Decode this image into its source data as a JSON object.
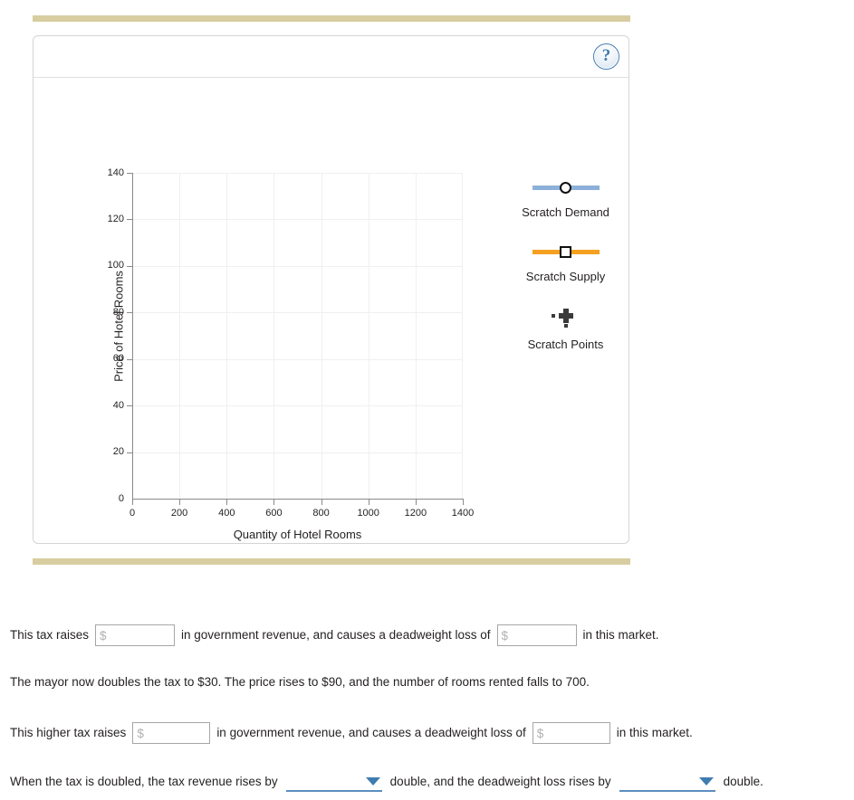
{
  "colors": {
    "rule_bar": "#d8cda0",
    "demand_line": "#8cb0d9",
    "supply_line": "#f5a020",
    "points_marker": "#3a3a3a",
    "dropdown_accent": "#3f7cb0",
    "help_accent": "#4a7fb5"
  },
  "panel": {
    "help_button_label": "?",
    "help_icon_name": "help-icon"
  },
  "chart_data": {
    "type": "scatter",
    "title": "",
    "xlabel": "Quantity of Hotel Rooms",
    "ylabel": "Price of Hotel Rooms",
    "xlim": [
      0,
      1400
    ],
    "ylim": [
      0,
      140
    ],
    "xticks": [
      0,
      200,
      400,
      600,
      800,
      1000,
      1200,
      1400
    ],
    "yticks": [
      0,
      20,
      40,
      60,
      80,
      100,
      120,
      140
    ],
    "grid": true,
    "legend_position": "right",
    "series": [
      {
        "name": "Scratch Demand",
        "marker": "circle",
        "color": "#8cb0d9",
        "values": []
      },
      {
        "name": "Scratch Supply",
        "marker": "square",
        "color": "#f5a020",
        "values": []
      },
      {
        "name": "Scratch Points",
        "marker": "cross",
        "color": "#3a3a3a",
        "values": []
      }
    ]
  },
  "legend": {
    "items": [
      {
        "label": "Scratch Demand"
      },
      {
        "label": "Scratch Supply"
      },
      {
        "label": "Scratch Points"
      }
    ]
  },
  "questions": {
    "line1": {
      "part1": "This tax raises",
      "part2": "in government revenue, and causes a deadweight loss of",
      "part3": "in this market.",
      "input1_value": "",
      "input1_placeholder": "$",
      "input2_value": "",
      "input2_placeholder": "$"
    },
    "line2": {
      "text": "The mayor now doubles the tax to $30. The price rises to $90, and the number of rooms rented falls to 700."
    },
    "line3": {
      "part1": "This higher tax raises",
      "part2": "in government revenue, and causes a deadweight loss of",
      "part3": "in this market.",
      "input1_value": "",
      "input1_placeholder": "$",
      "input2_value": "",
      "input2_placeholder": "$"
    },
    "line4": {
      "part1": "When the tax is doubled, the tax revenue rises by",
      "part2": "double, and the deadweight loss rises by",
      "part3": "double.",
      "select1_value": "",
      "select2_value": ""
    }
  }
}
